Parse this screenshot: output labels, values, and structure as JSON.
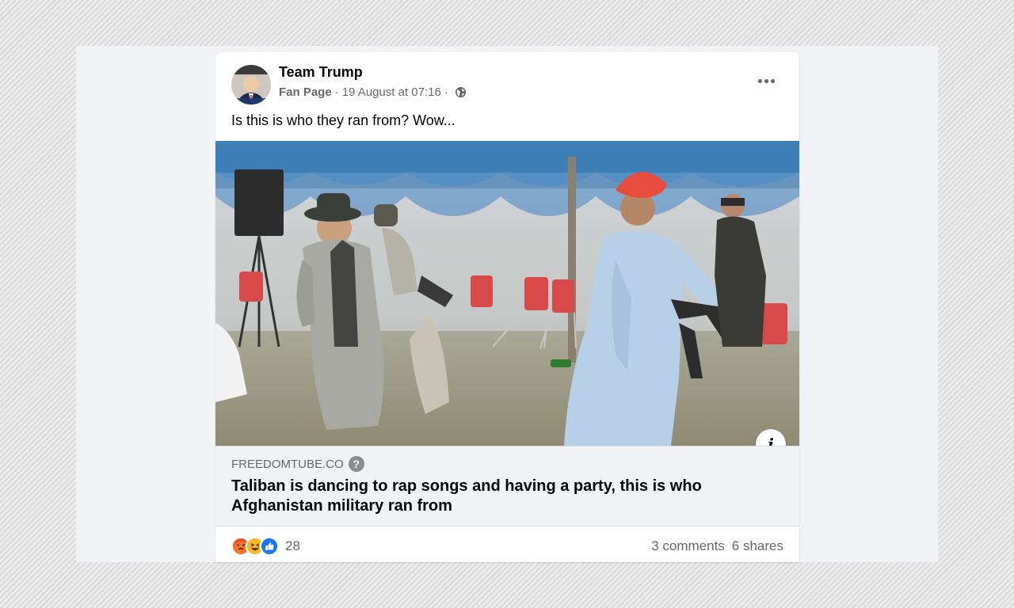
{
  "post": {
    "author": "Team Trump",
    "page_type": "Fan Page",
    "separator": "·",
    "timestamp": "19 August at 07:16",
    "privacy_icon": "globe-icon",
    "more_icon": "more-horizontal-icon",
    "message": "Is this is who they ran from? Wow..."
  },
  "link": {
    "domain": "FREEDOMTUBE.CO",
    "help_symbol": "?",
    "title": "Taliban is dancing to rap songs and having a party, this is who Afghanistan military ran from",
    "info_symbol": "i"
  },
  "footer": {
    "reaction_icons": [
      "angry-reaction-icon",
      "haha-reaction-icon",
      "like-reaction-icon"
    ],
    "reaction_count": "28",
    "comments": "3 comments",
    "shares": "6 shares"
  },
  "colors": {
    "text_primary": "#050505",
    "text_secondary": "#65676b",
    "link_bg": "#f0f2f5",
    "like_blue": "#1877f2",
    "angry_orange": "#f0502a",
    "haha_yellow": "#f7b928"
  }
}
